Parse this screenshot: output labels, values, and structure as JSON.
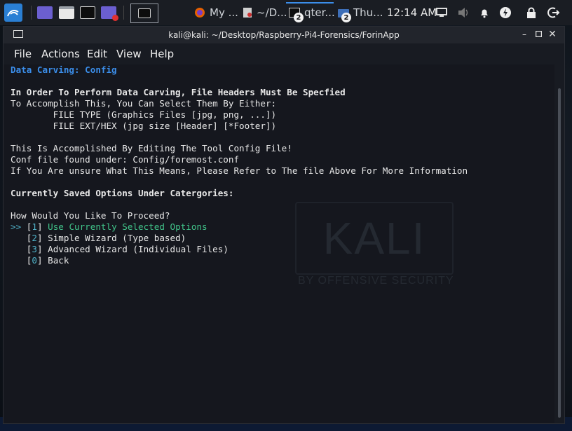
{
  "panel": {
    "tasks": [
      {
        "label": "My ..."
      },
      {
        "label": "~/D..."
      },
      {
        "label": "qter...",
        "badge": "2"
      },
      {
        "label": "Thu...",
        "badge": "2"
      }
    ],
    "clock": "12:14 AM"
  },
  "window": {
    "title": "kali@kali: ~/Desktop/Raspberry-Pi4-Forensics/ForinApp",
    "menu": [
      "File",
      "Actions",
      "Edit",
      "View",
      "Help"
    ]
  },
  "terminal": {
    "heading": "Data Carving: Config",
    "bold_intro": "In Order To Perform Data Carving, File Headers Must Be Specfied",
    "lines1": [
      "To Accomplish This, You Can Select Them By Either:",
      "        FILE TYPE (Graphics Files [jpg, png, ...])",
      "        FILE EXT/HEX (jpg size [Header] [*Footer])"
    ],
    "lines2": [
      "This Is Accomplished By Editing The Tool Config File!",
      "Conf file found under: Config/foremost.conf",
      "If You Are unsure What This Means, Please Refer to The file Above For More Information"
    ],
    "saved_heading": "Currently Saved Options Under Catergories:",
    "prompt": "How Would You Like To Proceed?",
    "cursor": ">>",
    "options": [
      {
        "num": "1",
        "label": "Use Currently Selected Options"
      },
      {
        "num": "2",
        "label": "Simple Wizard (Type based)"
      },
      {
        "num": "3",
        "label": "Advanced Wizard (Individual Files)"
      },
      {
        "num": "0",
        "label": "Back"
      }
    ]
  },
  "watermark": {
    "logo": "KALI",
    "tagline": "BY OFFENSIVE SECURITY"
  },
  "colors": {
    "accent": "#3b8eea",
    "selected": "#41c48a",
    "bracket_num": "#4fb0c6"
  }
}
